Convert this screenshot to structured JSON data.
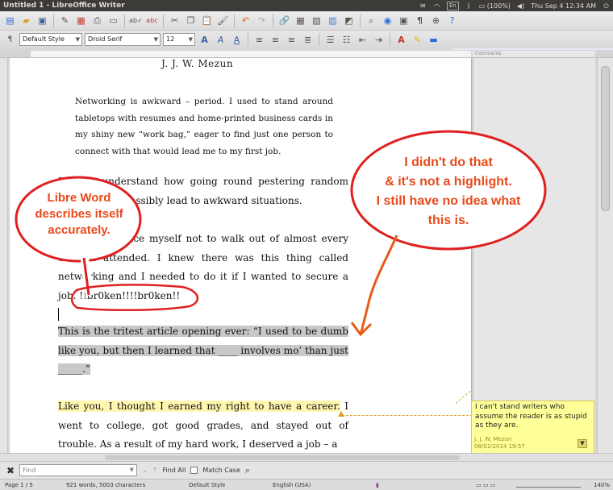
{
  "window": {
    "title": "Untitled 1 - LibreOffice Writer",
    "indicators": {
      "keyboard": "En",
      "battery": "(100%)",
      "volume": "◀)",
      "clock": "Thu Sep  4 12:34 AM"
    }
  },
  "toolbar": {
    "style": "Default Style",
    "font": "Droid Serif",
    "size": "12"
  },
  "ruler": {
    "comments_label": "Comments"
  },
  "document": {
    "author": "J. J. W. Mezun",
    "quote": "Networking is awkward – period. I used to stand around tabletops with resumes and home-printed business cards in my shiny new “work bag,” eager to find just one person to connect with that would lead me to my first job.",
    "p1": "I didn’t understand how going round pestering random people could possibly lead to awkward situations.",
    "p2a": "I would convince myself not to walk out of almost every event I attended. I knew there was this thing called networking and I needed to do it if I wanted to secure a job. ",
    "p2b": "!!br0ken!!!!br0ken!!",
    "p3": "This is the tritest article opening ever: “I used to be dumb like you, but then I learned that ____ involves mo’ than just _____.”",
    "p4a": "Like you, I thought I earned my right to have a career.",
    "p4b": " I went to college, got good grades, and stayed out of trouble. As a result of my hard work, I deserved a job – a"
  },
  "comment": {
    "text": "I can't stand writers who assume the reader is as stupid as they are.",
    "author": "J. J. W. Mezun",
    "date": "08/01/2014 19:57"
  },
  "annotations": {
    "left_bubble": [
      "Libre Word",
      "describes itself",
      "accurately."
    ],
    "right_bubble": [
      "I didn't do that",
      "& it's not a highlight.",
      "I still have no idea what",
      "this is."
    ],
    "color": "#e84a1a"
  },
  "findbar": {
    "placeholder": "Find",
    "find_all": "Find All",
    "match_case": "Match Case"
  },
  "status": {
    "page": "Page 1 / 5",
    "words": "921 words, 5003 characters",
    "style": "Default Style",
    "language": "English (USA)",
    "zoom": "140%"
  }
}
